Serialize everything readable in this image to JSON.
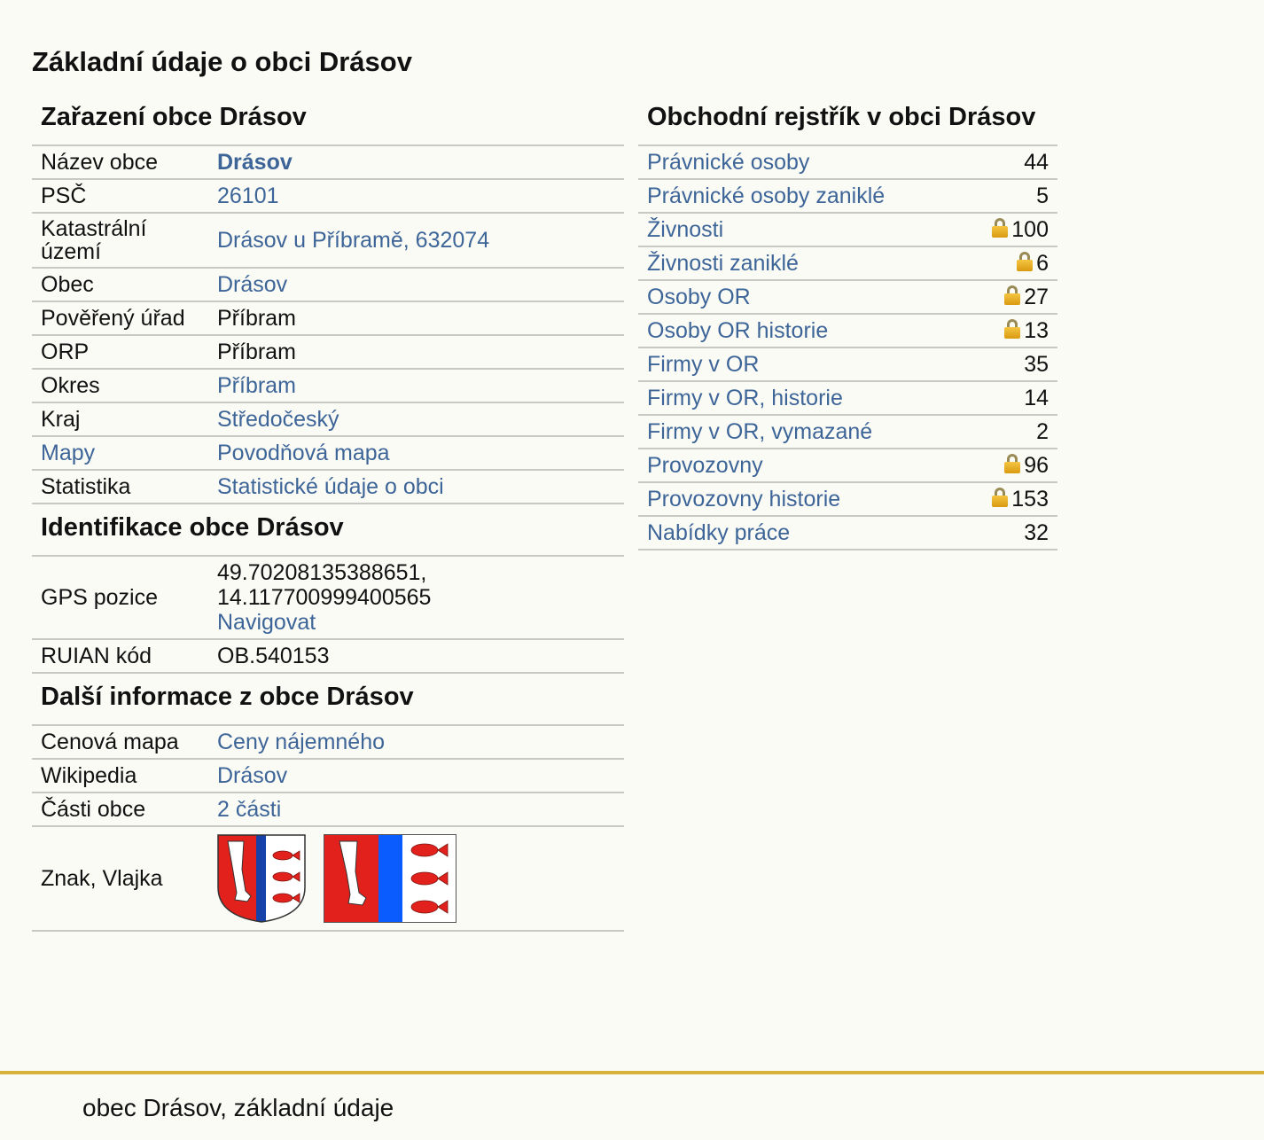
{
  "page": {
    "title": "Základní údaje o obci Drásov"
  },
  "classification": {
    "title": "Zařazení obce Drásov",
    "rows": [
      {
        "label": "Název obce",
        "value": "Drásov"
      },
      {
        "label": "PSČ",
        "value": "26101"
      },
      {
        "label": "Katastrální území",
        "value": "Drásov u Příbramě, 632074"
      },
      {
        "label": "Obec",
        "value": "Drásov"
      },
      {
        "label": "Pověřený úřad",
        "value": "Příbram"
      },
      {
        "label": "ORP",
        "value": "Příbram"
      },
      {
        "label": "Okres",
        "value": "Příbram"
      },
      {
        "label": "Kraj",
        "value": "Středočeský"
      },
      {
        "label": "Mapy",
        "value": "Povodňová mapa"
      },
      {
        "label": "Statistika",
        "value": "Statistické údaje o obci"
      }
    ]
  },
  "identification": {
    "title": "Identifikace obce Drásov",
    "gps_label": "GPS pozice",
    "gps_lat": "49.70208135388651,",
    "gps_lon": "14.117700999400565",
    "navigate": "Navigovat",
    "ruian_label": "RUIAN kód",
    "ruian_value": "OB.540153"
  },
  "more_info": {
    "title": "Další informace z obce Drásov",
    "rows": [
      {
        "label": "Cenová mapa",
        "value": "Ceny nájemného"
      },
      {
        "label": "Wikipedia",
        "value": "Drásov"
      },
      {
        "label": "Části obce",
        "value": "2 části"
      }
    ],
    "emblem_label": "Znak, Vlajka"
  },
  "registry": {
    "title": "Obchodní rejstřík v obci Drásov",
    "rows": [
      {
        "label": "Právnické osoby",
        "count": "44",
        "locked": false
      },
      {
        "label": "Právnické osoby zaniklé",
        "count": "5",
        "locked": false
      },
      {
        "label": "Živnosti",
        "count": "100",
        "locked": true
      },
      {
        "label": "Živnosti zaniklé",
        "count": "6",
        "locked": true
      },
      {
        "label": "Osoby OR",
        "count": "27",
        "locked": true
      },
      {
        "label": "Osoby OR historie",
        "count": "13",
        "locked": true
      },
      {
        "label": "Firmy v OR",
        "count": "35",
        "locked": false
      },
      {
        "label": "Firmy v OR, historie",
        "count": "14",
        "locked": false
      },
      {
        "label": "Firmy v OR, vymazané",
        "count": "2",
        "locked": false
      },
      {
        "label": "Provozovny",
        "count": "96",
        "locked": true
      },
      {
        "label": "Provozovny historie",
        "count": "153",
        "locked": true
      },
      {
        "label": "Nabídky práce",
        "count": "32",
        "locked": false
      }
    ]
  },
  "footer": {
    "text": "obec Drásov, základní údaje"
  },
  "colors": {
    "link": "#3d6598",
    "background": "#fbfbf6",
    "footer_border": "#d6b23a",
    "emblem_red": "#e2211c",
    "emblem_blue": "#1541a8",
    "flag_blue": "#0a5cff"
  }
}
